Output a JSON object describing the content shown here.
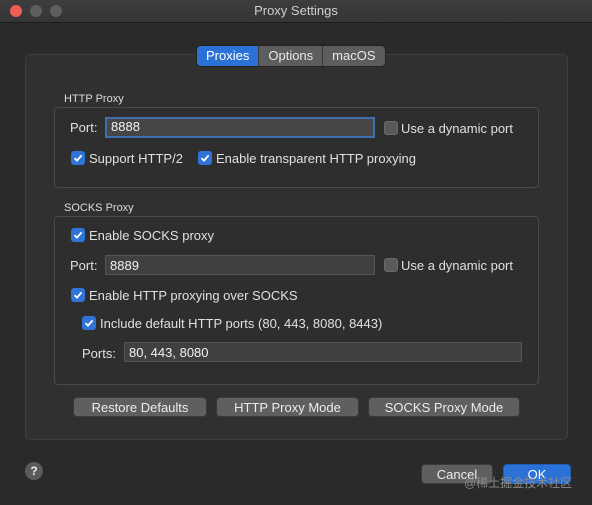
{
  "window": {
    "title": "Proxy Settings"
  },
  "tabs": [
    "Proxies",
    "Options",
    "macOS"
  ],
  "http_proxy": {
    "section_title": "HTTP Proxy",
    "port_label": "Port:",
    "port_value": "8888",
    "dynamic_port_label": "Use a dynamic port",
    "dynamic_port_checked": false,
    "http2_label": "Support HTTP/2",
    "http2_checked": true,
    "transparent_label": "Enable transparent HTTP proxying",
    "transparent_checked": true
  },
  "socks_proxy": {
    "section_title": "SOCKS Proxy",
    "enable_label": "Enable SOCKS proxy",
    "enable_checked": true,
    "port_label": "Port:",
    "port_value": "8889",
    "dynamic_port_label": "Use a dynamic port",
    "dynamic_port_checked": false,
    "http_over_socks_label": "Enable HTTP proxying over SOCKS",
    "http_over_socks_checked": true,
    "include_default_label": "Include default HTTP ports (80, 443, 8080, 8443)",
    "include_default_checked": true,
    "ports_label": "Ports:",
    "ports_value": "80, 443, 8080"
  },
  "buttons": {
    "restore_defaults": "Restore Defaults",
    "http_proxy_mode": "HTTP Proxy Mode",
    "socks_proxy_mode": "SOCKS Proxy Mode",
    "cancel": "Cancel",
    "ok": "OK",
    "help": "?"
  },
  "watermark": "@稀土掘金技术社区",
  "colors": {
    "accent": "#2b72d8",
    "background": "#2a2a2a"
  }
}
